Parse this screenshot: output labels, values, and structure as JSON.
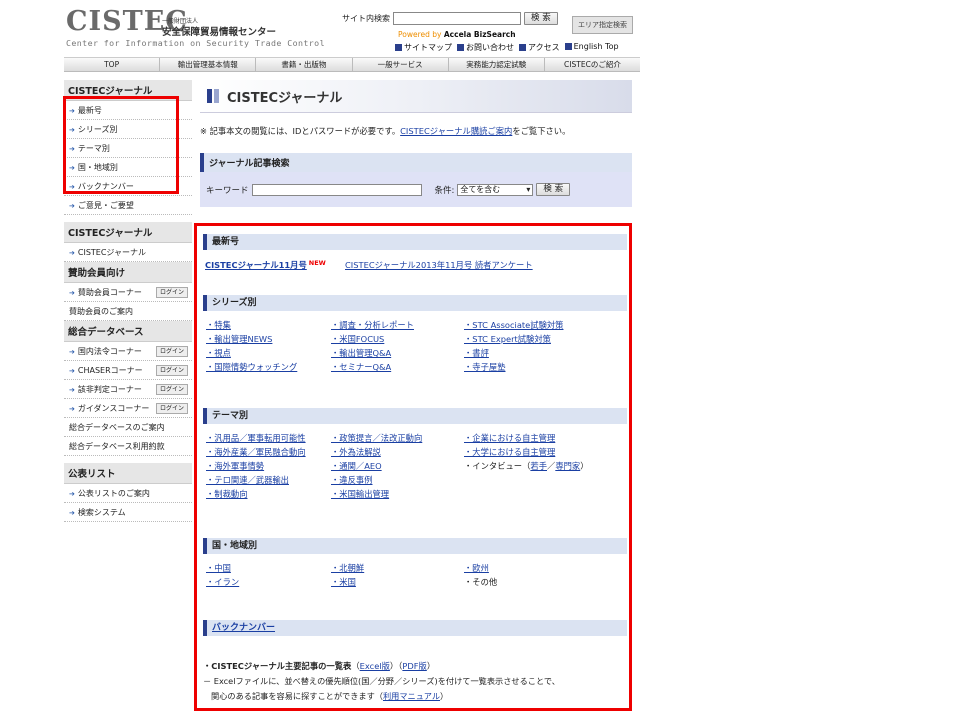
{
  "header": {
    "logo": "CISTEC",
    "org_small": "一般財団法人",
    "org_name": "安全保障貿易情報センター",
    "org_en": "Center for Information on Security Trade Control",
    "site_search_label": "サイト内検索",
    "search_button": "検 索",
    "area_button": "エリア指定検索",
    "powered_by": "Powered by",
    "powered_name": "Accela BizSearch",
    "links": [
      "サイトマップ",
      "お問い合わせ",
      "アクセス",
      "English Top"
    ]
  },
  "nav": [
    "TOP",
    "輸出管理基本情報",
    "書籍・出版物",
    "一般サービス",
    "実務能力認定試験",
    "CISTECのご紹介"
  ],
  "sidebar": {
    "journal_head": "CISTECジャーナル",
    "journal_items": [
      "最新号",
      "シリーズ別",
      "テーマ別",
      "国・地域別",
      "バックナンバー",
      "ご意見・ご要望"
    ],
    "journal2_head": "CISTECジャーナル",
    "journal2_items": [
      "CISTECジャーナル"
    ],
    "member_head": "賛助会員向け",
    "member_items": [
      "賛助会員コーナー",
      "賛助会員のご案内"
    ],
    "db_head": "総合データベース",
    "db_items": [
      "国内法令コーナー",
      "CHASERコーナー",
      "該非判定コーナー",
      "ガイダンスコーナー",
      "総合データベースのご案内",
      "総合データベース利用約款"
    ],
    "public_head": "公表リスト",
    "public_items": [
      "公表リストのご案内",
      "検索システム"
    ],
    "login": "ログイン"
  },
  "main": {
    "title": "CISTECジャーナル",
    "notice_pre": "※ 記事本文の閲覧には、IDとパスワードが必要です。",
    "notice_link": "CISTECジャーナル購読ご案内",
    "notice_post": "をご覧下さい。",
    "search_head": "ジャーナル記事検索",
    "keyword_label": "キーワード",
    "condition_label": "条件:",
    "condition_value": "全てを含む",
    "search_button": "検 索"
  },
  "latest": {
    "head": "最新号",
    "issue": "CISTECジャーナル11月号",
    "new": "NEW",
    "survey": "CISTECジャーナル2013年11月号 読者アンケート"
  },
  "series": {
    "head": "シリーズ別",
    "col1": [
      "・特集",
      "・輸出管理NEWS",
      "・視点",
      "・国際情勢ウォッチング"
    ],
    "col2": [
      "・調査・分析レポート",
      "・米国FOCUS",
      "・輸出管理Q&A",
      "・セミナーQ&A"
    ],
    "col3": [
      "・STC Associate試験対策",
      "・STC Expert試験対策",
      "・書評",
      "・寺子屋塾"
    ]
  },
  "theme": {
    "head": "テーマ別",
    "col1": [
      "・汎用品／軍事転用可能性",
      "・海外産業／軍民融合動向",
      "・海外軍事情勢",
      "・テロ関連／武器輸出",
      "・制裁動向"
    ],
    "col2": [
      "・政策提言／法改正動向",
      "・外為法解説",
      "・通関／AEO",
      "・違反事例",
      "・米国輸出管理"
    ],
    "col3": [
      "・企業における自主管理",
      "・大学における自主管理"
    ],
    "interview_pre": "・インタビュー（",
    "interview_a": "若手",
    "interview_sep": "／",
    "interview_b": "専門家",
    "interview_post": "）"
  },
  "region": {
    "head": "国・地域別",
    "col1": [
      "・中国",
      "・イラン"
    ],
    "col2": [
      "・北朝鮮",
      "・米国"
    ],
    "col3": [
      "・欧州"
    ],
    "other": "・その他"
  },
  "backnumber": {
    "head": "バックナンバー",
    "list_title": "・CISTECジャーナル主要記事の一覧表",
    "excel": "Excel版",
    "pdf": "PDF版",
    "desc1": "－ Excelファイルに、並べ替えの優先順位(国／分野／シリーズ)を付けて一覧表示させることで、",
    "desc2": "関心のある記事を容易に探すことができます（",
    "manual": "利用マニュアル",
    "desc2_post": "）"
  },
  "colors": {
    "accent": "#2a3f8c",
    "highlight_box": "#e00000",
    "link": "#1a3fa3"
  }
}
